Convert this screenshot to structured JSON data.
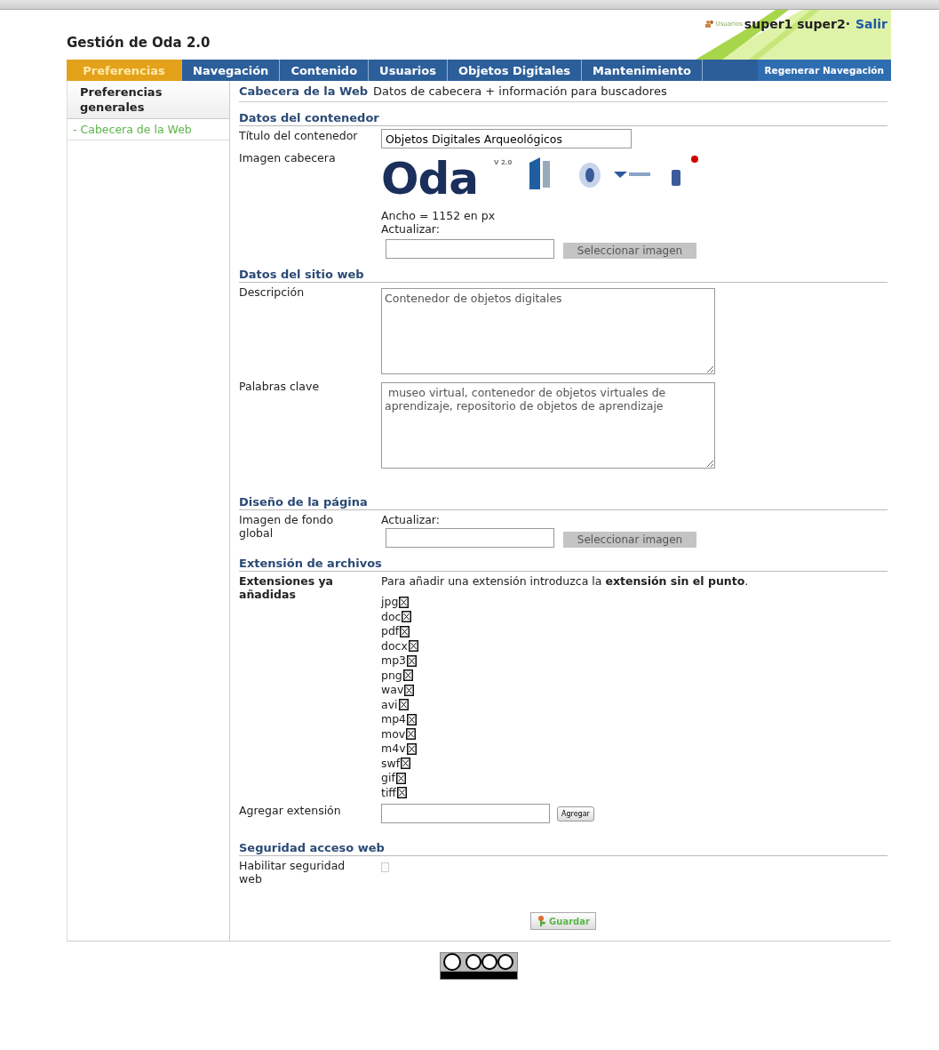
{
  "header": {
    "title": "Gestión de Oda 2.0",
    "user_label": "Usuarios",
    "users": "super1 super2·",
    "logout": "Salir"
  },
  "tabs": [
    {
      "label": "Preferencias",
      "selected": true
    },
    {
      "label": "Navegación",
      "selected": false
    },
    {
      "label": "Contenido",
      "selected": false
    },
    {
      "label": "Usuarios",
      "selected": false
    },
    {
      "label": "Objetos Digitales",
      "selected": false
    },
    {
      "label": "Mantenimiento",
      "selected": false
    }
  ],
  "regen_button": "Regenerar Navegación",
  "sidebar": {
    "heading": "Preferencias generales",
    "items": [
      {
        "marker": "-",
        "label": "Cabecera de la Web",
        "selected": true
      }
    ]
  },
  "page": {
    "title": "Cabecera de la Web",
    "subtitle": "Datos de cabecera + información para buscadores"
  },
  "container": {
    "heading": "Datos del contenedor",
    "title_label": "Título del contenedor",
    "title_value": "Objetos Digitales Arqueológicos",
    "image_label": "Imagen cabecera",
    "logo": "Oda",
    "logo_version": "V 2.0",
    "width_note": "Ancho = 1152 en px",
    "update_label": "Actualizar:",
    "select_button": "Seleccionar imagen"
  },
  "site": {
    "heading": "Datos del sitio web",
    "description_label": "Descripción",
    "description": "Contenedor de objetos digitales",
    "keywords_label": "Palabras clave",
    "keywords": " museo virtual, contenedor de objetos virtuales de aprendizaje, repositorio de objetos de aprendizaje"
  },
  "design": {
    "heading": "Diseño de la página",
    "bg_label": "Imagen de fondo global",
    "update_label": "Actualizar:",
    "select_button": "Seleccionar imagen"
  },
  "extensions": {
    "heading": "Extensión de archivos",
    "list_label": "Extensiones ya añadidas",
    "hint": "Para añadir una extensión introduzca la **extensión sin el punto**.",
    "items": [
      "jpg",
      "doc",
      "pdf",
      "docx",
      "mp3",
      "png",
      "wav",
      "avi",
      "mp4",
      "mov",
      "m4v",
      "swf",
      "gif",
      "tiff"
    ],
    "add_label": "Agregar extensión",
    "add_button": "Agregar"
  },
  "security": {
    "heading": "Seguridad acceso web",
    "label": "Habilitar seguridad web",
    "checked": false
  },
  "save_button": "Guardar"
}
